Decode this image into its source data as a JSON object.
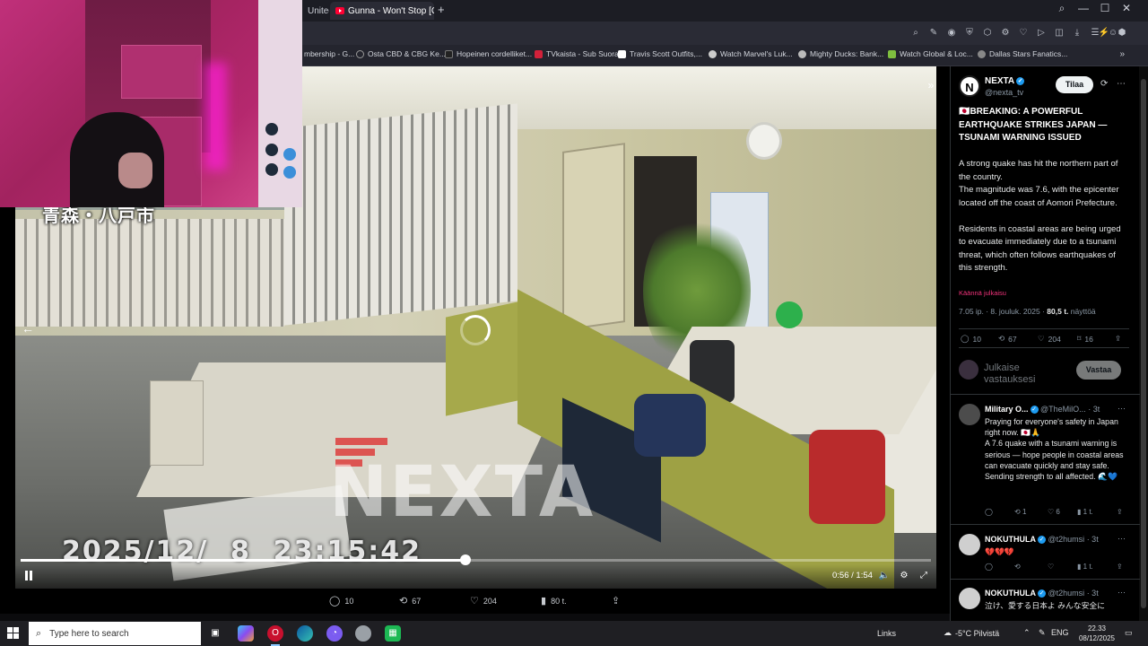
{
  "browser": {
    "tabs": [
      {
        "label": "United"
      },
      {
        "label": "Gunna - Won't Stop [Offi"
      }
    ],
    "bookmarks": [
      {
        "label": "mbership - G...",
        "color": "#4a4a55"
      },
      {
        "label": "Osta CBD & CBG Ke...",
        "color": "#6b6b6b"
      },
      {
        "label": "Hopeinen cordelliket...",
        "color": "#222222"
      },
      {
        "label": "TVkaista - Sub Suora",
        "color": "#d3213a"
      },
      {
        "label": "Travis Scott Outfits,...",
        "color": "#ffffff"
      },
      {
        "label": "Watch Marvel's Luk...",
        "color": "#cccccc"
      },
      {
        "label": "Mighty Ducks: Bank...",
        "color": "#bbbbbb"
      },
      {
        "label": "Watch Global & Loc...",
        "color": "#7fbf3f"
      },
      {
        "label": "Dallas Stars Fanatics...",
        "color": "#888888"
      }
    ],
    "bookmarks_more": "»"
  },
  "video": {
    "location_overlay": "青森・八戸市",
    "watermark": "NEXTA",
    "timestamp": "2025/12/  8  23:15:42",
    "progress": 0.4883,
    "time": "0:56 / 1:54"
  },
  "actions": {
    "replies": "10",
    "reposts": "67",
    "likes": "204",
    "views": "80 t.",
    "share_icon": "share-icon"
  },
  "post": {
    "avatar_letter": "N",
    "author": "NEXTA",
    "handle": "@nexta_tv",
    "subscribe": "Tilaa",
    "title": "🇯🇵BREAKING: A POWERFUL EARTHQUAKE STRIKES JAPAN — TSUNAMI WARNING ISSUED",
    "body": "A strong quake has hit the northern part of the country.\nThe magnitude was 7.6, with the epicenter located off the coast of Aomori Prefecture.\n\nResidents in coastal areas are being urged to evacuate immediately due to a tsunami threat, which often follows earthquakes of this strength.",
    "translate": "Käännä julkaisu",
    "meta_time": "7.05 ip. · 8. jouluk. 2025 ·",
    "meta_views": "80,5 t.",
    "meta_views_label": "näyttöä",
    "stats": {
      "replies": "10",
      "reposts": "67",
      "likes": "204",
      "bookmarks": "16"
    },
    "reply_placeholder": "Julkaise vastauksesi",
    "reply_button": "Vastaa"
  },
  "replies": [
    {
      "name": "Military O...",
      "handle": "@TheMilO...",
      "time": "· 3t",
      "text": "Praying for everyone's safety in Japan right now. 🇯🇵🙏\nA 7.6 quake with a tsunami warning is serious — hope people in coastal areas can evacuate quickly and stay safe.\nSending strength to all affected. 🌊💙",
      "replies": "",
      "reposts": "1",
      "likes": "6",
      "views": "1 t.",
      "avatar_color": "#5a5a5a"
    },
    {
      "name": "NOKUTHULA",
      "handle": "@t2humsi",
      "time": "· 3t",
      "text": "💔💔💔",
      "replies": "",
      "reposts": "",
      "likes": "",
      "views": "1 t.",
      "avatar_color": "#c9c9c9"
    },
    {
      "name": "NOKUTHULA",
      "handle": "@t2humsi",
      "time": "· 3t",
      "text": "泣け、愛する日本よ みんな安全に",
      "replies": "",
      "reposts": "",
      "likes": "",
      "views": "",
      "avatar_color": "#c9c9c9"
    }
  ],
  "taskbar": {
    "search_placeholder": "Type here to search",
    "links": "Links",
    "weather": "-5°C  Pilvistä",
    "language": "ENG",
    "time": "22.33",
    "date": "08/12/2025"
  }
}
